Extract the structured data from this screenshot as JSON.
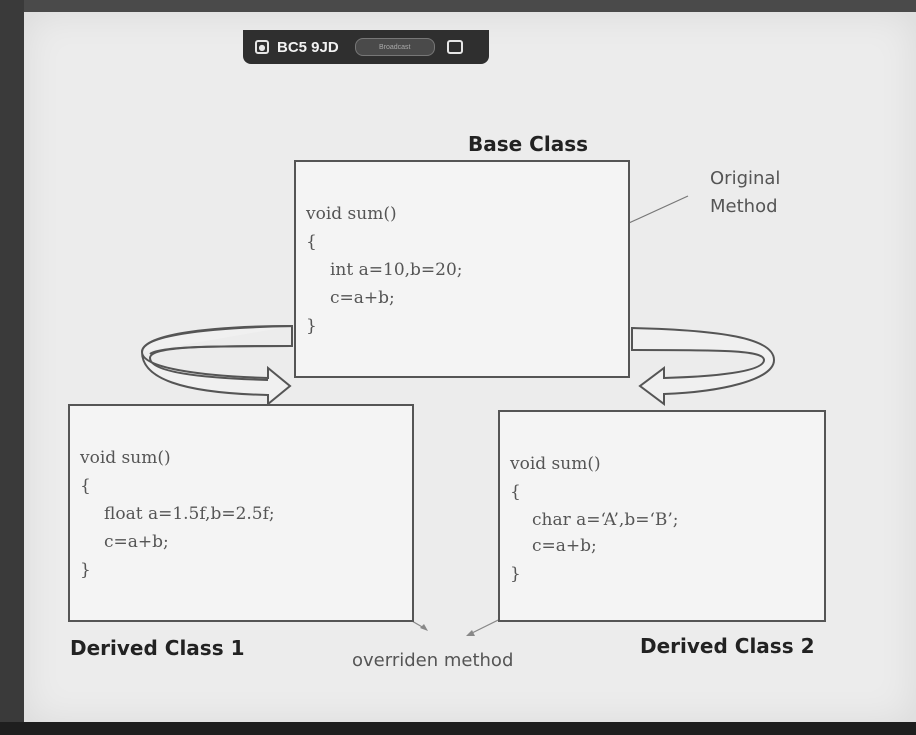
{
  "toolbar": {
    "meeting_code": "BC5 9JD",
    "pill_label": "Broadcast"
  },
  "diagram": {
    "base": {
      "title": "Base Class",
      "lines": [
        "void sum()",
        "{",
        "int a=10,b=20;",
        "c=a+b;",
        "}"
      ]
    },
    "derived1": {
      "title": "Derived Class 1",
      "lines": [
        "void sum()",
        "{",
        "float a=1.5f,b=2.5f;",
        "c=a+b;",
        "}"
      ]
    },
    "derived2": {
      "title": "Derived Class 2",
      "lines": [
        "void sum()",
        "{",
        "char a=‘A’,b=‘B’;",
        "c=a+b;",
        "}"
      ]
    },
    "original_label": [
      "Original",
      "Method"
    ],
    "overridden_label": "overriden method"
  },
  "colors": {
    "screen": "#ececec",
    "box_border": "#555555",
    "toolbar": "#2f2f2f"
  }
}
